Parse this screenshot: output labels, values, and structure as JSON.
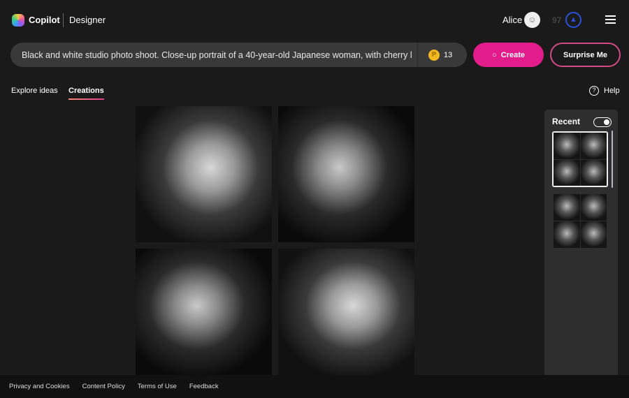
{
  "header": {
    "brand": "Copilot",
    "product": "Designer",
    "user_name": "Alice",
    "points": "97",
    "icons": [
      "copilot-logo",
      "user-icon",
      "trophy-icon",
      "hamburger-menu-icon"
    ]
  },
  "prompt": {
    "value": "Black and white studio photo shoot. Close-up portrait of a 40-year-old Japanese woman, with cherry l",
    "boosts": "13",
    "create_label": "Create",
    "surprise_label": "Surprise Me"
  },
  "tabs": [
    {
      "label": "Explore ideas",
      "active": false
    },
    {
      "label": "Creations",
      "active": true
    }
  ],
  "help_label": "Help",
  "recent": {
    "label": "Recent",
    "toggle_on": true
  },
  "footer": [
    "Privacy and Cookies",
    "Content Policy",
    "Terms of Use",
    "Feedback"
  ],
  "colors": {
    "accent": "#e21c8a",
    "background": "#1b1a1a",
    "prompt_bg": "#3a3939"
  }
}
